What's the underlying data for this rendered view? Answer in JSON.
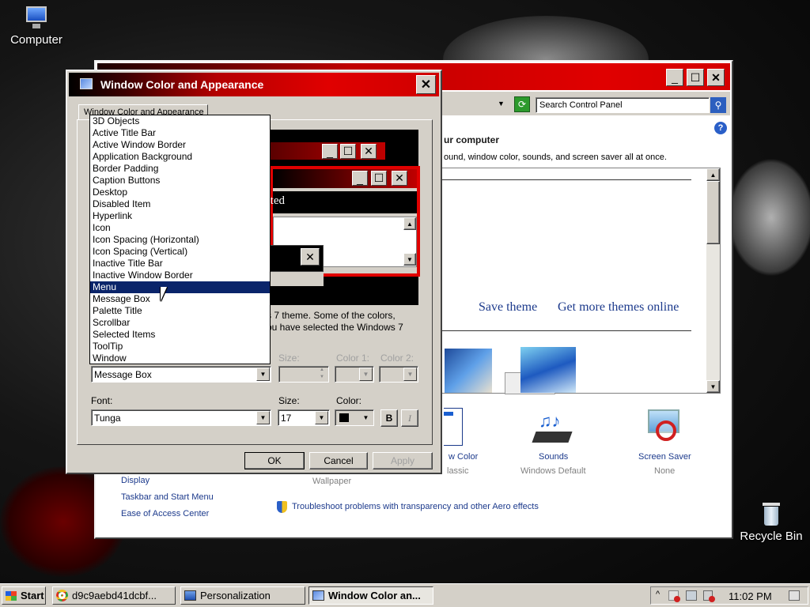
{
  "desktop": {
    "icons": [
      {
        "label": "Computer",
        "icon": "computer-icon"
      },
      {
        "label": "Recycle Bin",
        "icon": "recycle-bin-icon"
      }
    ]
  },
  "personalization": {
    "search_placeholder": "Search Control Panel",
    "heading_fragment": "ur computer",
    "desc_fragment": "ound, window color, sounds, and screen saver all at once.",
    "save_theme": "Save theme",
    "get_more_themes": "Get more themes online",
    "window_color_fragment": "w Color",
    "classic_fragment": "lassic",
    "sounds_label": "Sounds",
    "sounds_value": "Windows Default",
    "screensaver_label": "Screen Saver",
    "screensaver_value": "None",
    "wallpaper_label": "Wallpaper",
    "see_also": [
      "Display",
      "Taskbar and Start Menu",
      "Ease of Access Center"
    ],
    "troubleshoot": "Troubleshoot problems with transparency and other Aero effects"
  },
  "dialog": {
    "title": "Window Color and Appearance",
    "tab": "Window Color and Appearance",
    "preview_selected_fragment": "cted",
    "info_line1": "s 7 theme.  Some of the colors,",
    "info_line2": "ou have selected the Windows 7",
    "size_label": "Size:",
    "color1_label": "Color 1:",
    "color2_label": "Color 2:",
    "item_value": "Message Box",
    "font_label": "Font:",
    "font_value": "Tunga",
    "font_size_label": "Size:",
    "font_size_value": "17",
    "font_color_label": "Color:",
    "bold_label": "B",
    "italic_label": "I",
    "ok": "OK",
    "cancel": "Cancel",
    "apply": "Apply",
    "item_options": [
      "3D Objects",
      "Active Title Bar",
      "Active Window Border",
      "Application Background",
      "Border Padding",
      "Caption Buttons",
      "Desktop",
      "Disabled Item",
      "Hyperlink",
      "Icon",
      "Icon Spacing (Horizontal)",
      "Icon Spacing (Vertical)",
      "Inactive Title Bar",
      "Inactive Window Border",
      "Menu",
      "Message Box",
      "Palette Title",
      "Scrollbar",
      "Selected Items",
      "ToolTip",
      "Window"
    ],
    "highlighted_option": "Menu"
  },
  "taskbar": {
    "start": "Start",
    "tasks": [
      {
        "label": "d9c9aebd41dcbf...",
        "icon": "chrome-icon"
      },
      {
        "label": "Personalization",
        "icon": "control-panel-icon"
      },
      {
        "label": "Window Color an...",
        "icon": "window-color-icon"
      }
    ],
    "clock": "11:02 PM"
  },
  "colors": {
    "title_gradient_end": "#e00000",
    "selection": "#0a246a",
    "face": "#d4d0c8"
  }
}
